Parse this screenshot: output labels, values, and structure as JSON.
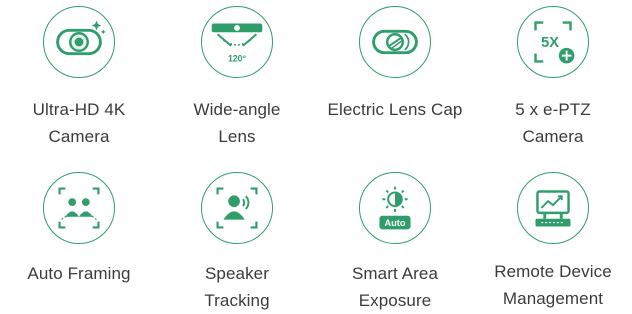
{
  "accent_color": "#2f9e6b",
  "features": [
    {
      "icon": "camera-lens-icon",
      "label_lines": [
        "Ultra-HD 4K",
        "Camera"
      ]
    },
    {
      "icon": "wide-angle-icon",
      "icon_text": "120°",
      "label_lines": [
        "Wide-angle",
        "Lens"
      ]
    },
    {
      "icon": "lens-cap-icon",
      "label_lines": [
        "Electric Lens Cap"
      ]
    },
    {
      "icon": "zoom-ptz-icon",
      "icon_text": "5X",
      "label_lines": [
        "5 x e-PTZ",
        "Camera"
      ]
    },
    {
      "icon": "auto-framing-icon",
      "label_lines": [
        "Auto Framing"
      ]
    },
    {
      "icon": "speaker-tracking-icon",
      "label_lines": [
        "Speaker",
        "Tracking"
      ]
    },
    {
      "icon": "exposure-icon",
      "icon_text": "Auto",
      "label_lines": [
        "Smart Area",
        "Exposure"
      ]
    },
    {
      "icon": "remote-management-icon",
      "label_lines": [
        "Remote Device",
        "Management"
      ]
    }
  ]
}
